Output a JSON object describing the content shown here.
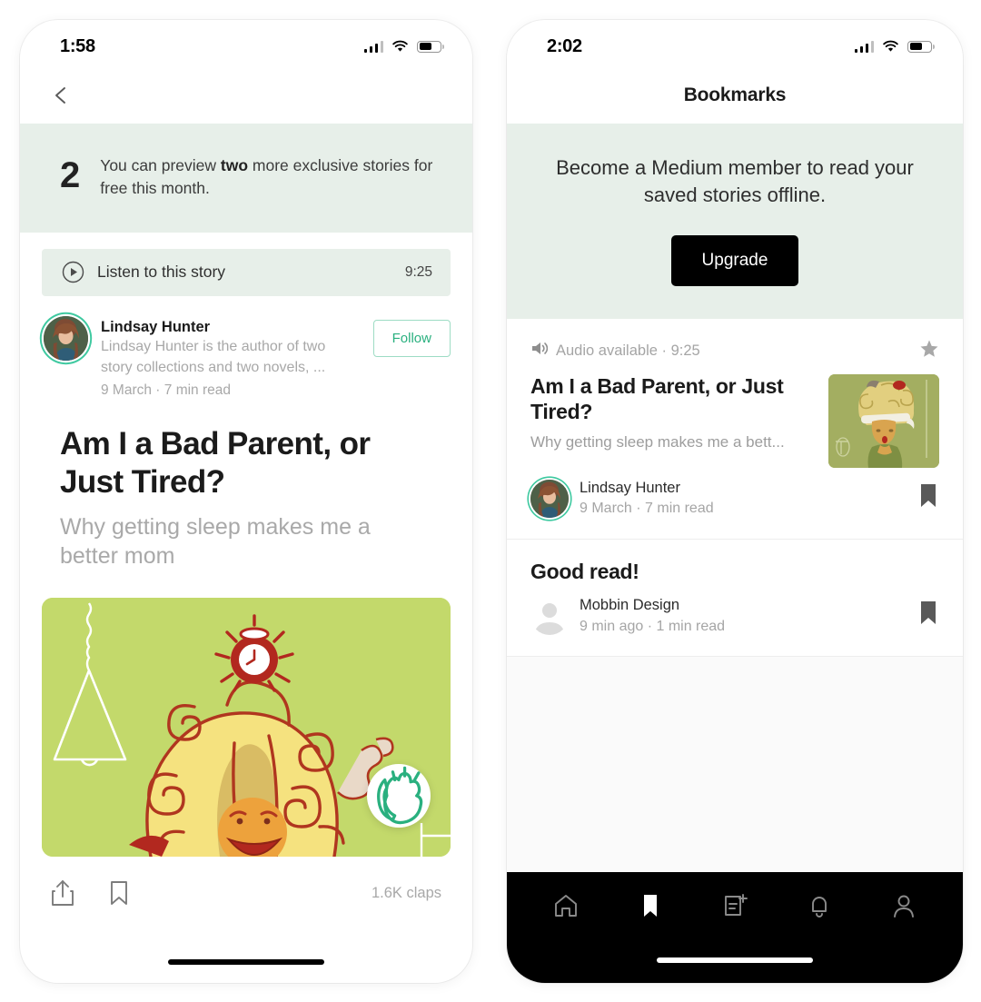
{
  "left_phone": {
    "status_bar": {
      "time": "1:58",
      "signal_icon": "cellular-signal-icon",
      "wifi_icon": "wifi-icon",
      "battery_icon": "battery-icon"
    },
    "nav": {
      "back_icon": "chevron-left-icon"
    },
    "preview_banner": {
      "count": "2",
      "text_before": "You can preview ",
      "text_bold": "two",
      "text_after": " more exclusive stories for free this month."
    },
    "listen_row": {
      "play_icon": "play-circle-icon",
      "label": "Listen to this story",
      "duration": "9:25"
    },
    "author": {
      "avatar_icon": "author-avatar",
      "name": "Lindsay Hunter",
      "bio": "Lindsay Hunter is the author of two story collections and two novels, ...",
      "meta": "9 March  ·  7 min read",
      "follow_label": "Follow"
    },
    "article": {
      "title": "Am I a Bad Parent, or Just Tired?",
      "subtitle": "Why getting sleep makes me a better mom",
      "hero_icon": "article-hero-illustration",
      "clap_icon": "clapping-hands-icon"
    },
    "actions": {
      "share_icon": "share-icon",
      "bookmark_icon": "bookmark-icon",
      "claps": "1.6K claps"
    }
  },
  "right_phone": {
    "status_bar": {
      "time": "2:02",
      "signal_icon": "cellular-signal-icon",
      "wifi_icon": "wifi-icon",
      "battery_icon": "battery-icon"
    },
    "nav": {
      "title": "Bookmarks"
    },
    "upgrade_banner": {
      "text": "Become a Medium member to read your saved stories offline.",
      "button_label": "Upgrade"
    },
    "bookmarks": [
      {
        "audio_icon": "speaker-icon",
        "audio_label": "Audio available  ·  9:25",
        "star_icon": "star-icon",
        "title": "Am I a Bad Parent, or Just Tired?",
        "subtitle": "Why getting sleep makes me a bett...",
        "thumbnail_icon": "story-thumbnail",
        "avatar_icon": "author-avatar",
        "author": "Lindsay Hunter",
        "meta": "9 March  ·  7 min read",
        "save_icon": "bookmark-filled-icon"
      },
      {
        "title": "Good read!",
        "avatar_icon": "default-avatar-icon",
        "author": "Mobbin Design",
        "meta": "9 min ago  ·  1 min read",
        "save_icon": "bookmark-filled-icon"
      }
    ],
    "tabbar": {
      "items": [
        {
          "name": "home",
          "icon": "home-icon",
          "active": false
        },
        {
          "name": "bookmarks",
          "icon": "bookmark-filled-icon",
          "active": true
        },
        {
          "name": "write",
          "icon": "new-story-icon",
          "active": false
        },
        {
          "name": "notifications",
          "icon": "bell-icon",
          "active": false
        },
        {
          "name": "profile",
          "icon": "person-icon",
          "active": false
        }
      ]
    }
  },
  "colors": {
    "banner_green": "#e7efe9",
    "accent_teal": "#2ab07f",
    "hero_green": "#c3d96b",
    "thumb_green": "#a3ae61",
    "muted_text": "#a8a8a8",
    "title_text": "#1b1b1b",
    "tabbar_black": "#000000"
  }
}
